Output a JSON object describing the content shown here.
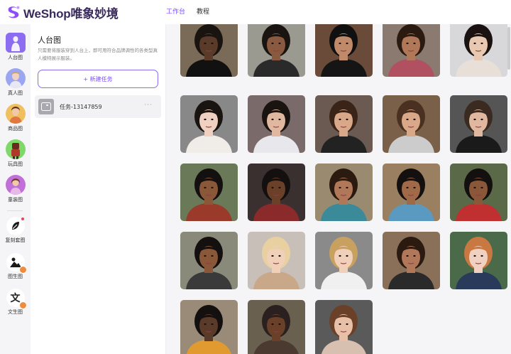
{
  "app": {
    "logo_text": "WeShop唯象妙境",
    "brand_color": "#7b4dff"
  },
  "nav": [
    {
      "label": "工作台",
      "active": true
    },
    {
      "label": "教程",
      "active": false
    }
  ],
  "rail": {
    "items": [
      {
        "label": "人台图",
        "active": true,
        "icon": "mannequin-icon"
      },
      {
        "label": "真人图",
        "active": false,
        "icon": "model-avatar-icon"
      },
      {
        "label": "商品图",
        "active": false,
        "icon": "product-avatar-icon"
      },
      {
        "label": "玩具图",
        "active": false,
        "icon": "toy-avatar-icon"
      },
      {
        "label": "童装图",
        "active": false,
        "icon": "kids-avatar-icon"
      }
    ],
    "tools": [
      {
        "label": "复刻套图",
        "icon": "leaf-icon",
        "badge": "dot"
      },
      {
        "label": "图生图",
        "icon": "image-icon",
        "badge": "pro"
      },
      {
        "label": "文生图",
        "icon": "text-icon",
        "badge": "pro",
        "glyph": "文"
      }
    ]
  },
  "panel": {
    "title": "人台图",
    "description": "只需要将服装穿到人台上，即可用符合品牌调性的各类型真人模特展示服装。",
    "new_task_label": "+ 新建任务",
    "tasks": [
      {
        "name": "任务-13147859",
        "more": "···"
      }
    ]
  },
  "gallery": {
    "models": [
      {
        "skin": "#5a3a28",
        "hair": "#1a1410",
        "bg": "#7a6a58",
        "top": "#111111"
      },
      {
        "skin": "#8a5a40",
        "hair": "#1a1410",
        "bg": "#9a9a90",
        "top": "#2a2a2a"
      },
      {
        "skin": "#c08a6a",
        "hair": "#101010",
        "bg": "#6a4a38",
        "top": "#151515"
      },
      {
        "skin": "#b07858",
        "hair": "#2a1a10",
        "bg": "#8a7a70",
        "top": "#b05060"
      },
      {
        "skin": "#e8c8b0",
        "hair": "#1a1210",
        "bg": "#d8d8da",
        "top": "#e8e0d8"
      },
      {
        "skin": "#f0d0c0",
        "hair": "#1a1410",
        "bg": "#888888",
        "top": "#f0ece8"
      },
      {
        "skin": "#e0b8a0",
        "hair": "#1a1410",
        "bg": "#7a6a6a",
        "top": "#e8e8ec"
      },
      {
        "skin": "#d8a888",
        "hair": "#3a2418",
        "bg": "#6a5a52",
        "top": "#222222"
      },
      {
        "skin": "#d8a888",
        "hair": "#4a3020",
        "bg": "#7a6048",
        "top": "#cccccc"
      },
      {
        "skin": "#e0b8a0",
        "hair": "#3a2a20",
        "bg": "#555555",
        "top": "#1a1a1a"
      },
      {
        "skin": "#8a5838",
        "hair": "#141010",
        "bg": "#6a7a58",
        "top": "#9a3a2a"
      },
      {
        "skin": "#6a4028",
        "hair": "#141010",
        "bg": "#3a3030",
        "top": "#8a2a2a"
      },
      {
        "skin": "#b07858",
        "hair": "#2a1a10",
        "bg": "#9a8a70",
        "top": "#3a8a9a"
      },
      {
        "skin": "#a06a48",
        "hair": "#141010",
        "bg": "#9a8060",
        "top": "#5a9ac0"
      },
      {
        "skin": "#8a5838",
        "hair": "#141010",
        "bg": "#5a6a48",
        "top": "#c03030"
      },
      {
        "skin": "#8a5838",
        "hair": "#141010",
        "bg": "#8a8a7a",
        "top": "#3a3a3a"
      },
      {
        "skin": "#f0d0b8",
        "hair": "#e8d0a0",
        "bg": "#c8c0b8",
        "top": "#c8a888"
      },
      {
        "skin": "#f0d0b8",
        "hair": "#c8a060",
        "bg": "#8a8a8a",
        "top": "#f0f0f0"
      },
      {
        "skin": "#b07858",
        "hair": "#2a1a10",
        "bg": "#8a7058",
        "top": "#2a2a2a"
      },
      {
        "skin": "#f0d0c0",
        "hair": "#c87840",
        "bg": "#4a6a4a",
        "top": "#2a3a5a"
      },
      {
        "skin": "#5a3a28",
        "hair": "#141010",
        "bg": "#9a8a78",
        "top": "#e09a30"
      },
      {
        "skin": "#6a4028",
        "hair": "#2a2020",
        "bg": "#6a6050",
        "top": "#4a3a30"
      },
      {
        "skin": "#e8c0a8",
        "hair": "#6a4028",
        "bg": "#5a5a5a",
        "top": "#d8c0b0"
      }
    ]
  }
}
